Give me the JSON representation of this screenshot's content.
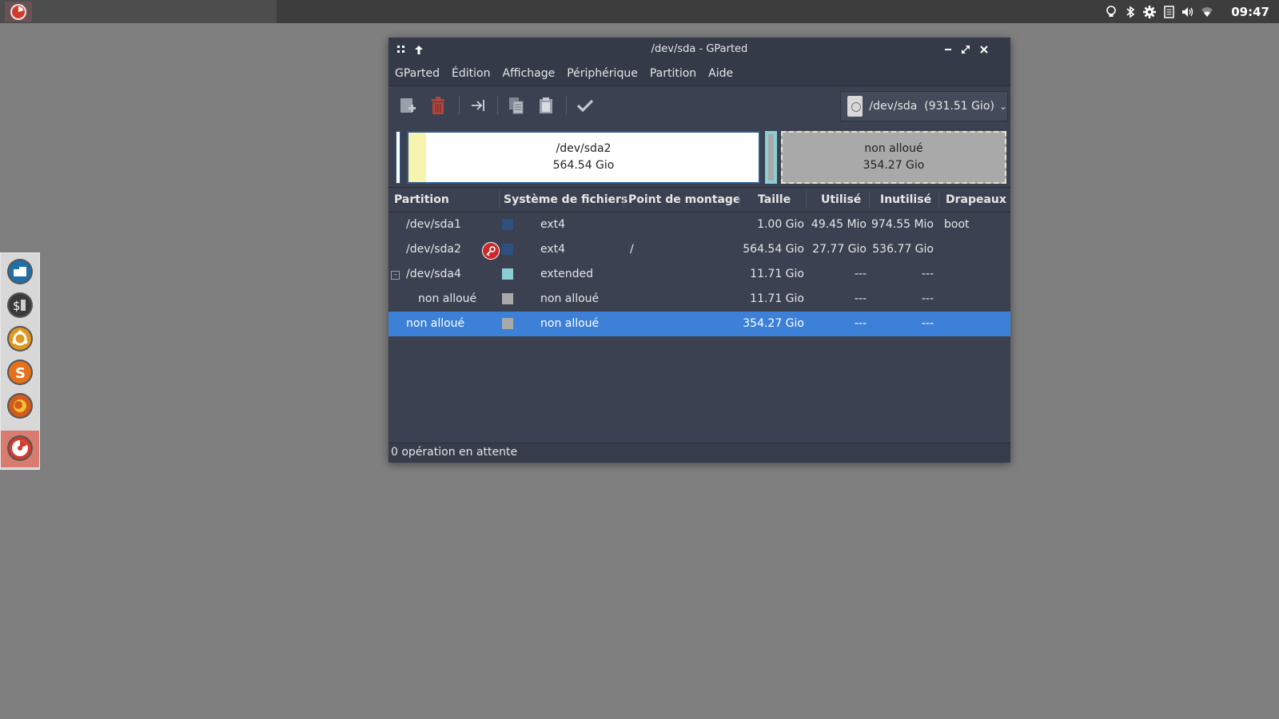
{
  "top_panel": {
    "clock": "09:47",
    "tray_icons": [
      "lightbulb-icon",
      "bluetooth-icon",
      "settings-gear-icon",
      "clipboard-icon",
      "volume-icon",
      "wifi-icon"
    ]
  },
  "dock": {
    "items": [
      "files-icon",
      "terminal-icon",
      "software-center-icon",
      "app-s-icon",
      "firefox-icon",
      "gparted-icon"
    ]
  },
  "window": {
    "title": "/dev/sda - GParted",
    "menu": [
      "GParted",
      "Édition",
      "Affichage",
      "Périphérique",
      "Partition",
      "Aide"
    ],
    "device_selector": "/dev/sda  (931.51 Gio)",
    "graph": {
      "sda2_name": "/dev/sda2",
      "sda2_size": "564.54 Gio",
      "unalloc_name": "non alloué",
      "unalloc_size": "354.27 Gio"
    },
    "columns": [
      "Partition",
      "Système de fichiers",
      "Point de montage",
      "Taille",
      "Utilisé",
      "Inutilisé",
      "Drapeaux"
    ],
    "rows": [
      {
        "partition": "/dev/sda1",
        "fs": "ext4",
        "mount": "",
        "size": "1.00 Gio",
        "used": "49.45 Mio",
        "unused": "974.55 Mio",
        "flags": "boot",
        "color": "#2f4f7f"
      },
      {
        "partition": "/dev/sda2",
        "fs": "ext4",
        "mount": "/",
        "size": "564.54 Gio",
        "used": "27.77 Gio",
        "unused": "536.77 Gio",
        "flags": "",
        "color": "#2f4f7f"
      },
      {
        "partition": "/dev/sda4",
        "fs": "extended",
        "mount": "",
        "size": "11.71 Gio",
        "used": "---",
        "unused": "---",
        "flags": "",
        "color": "#89cfd4"
      },
      {
        "partition": "non alloué",
        "fs": "non alloué",
        "mount": "",
        "size": "11.71 Gio",
        "used": "---",
        "unused": "---",
        "flags": "",
        "color": "#a9a9a9"
      },
      {
        "partition": "non alloué",
        "fs": "non alloué",
        "mount": "",
        "size": "354.27 Gio",
        "used": "---",
        "unused": "---",
        "flags": "",
        "color": "#a9a9a9"
      }
    ],
    "status": "0 opération en attente"
  },
  "colors": {
    "selected_row": "#3d80d8",
    "ext4": "#2f4f7f",
    "extended": "#89cfd4",
    "unallocated": "#a9a9a9"
  }
}
